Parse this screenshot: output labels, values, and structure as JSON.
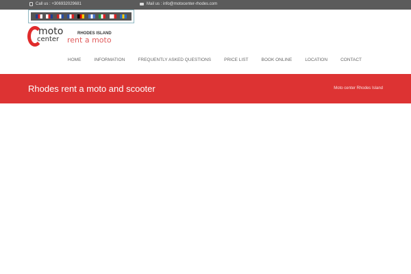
{
  "topbar": {
    "call": "Call us : +306932029681",
    "mail": "Mail us : info@motocenter-rhodes.com"
  },
  "flags": [
    {
      "lang": "English",
      "colors": [
        "#1f3f8f",
        "#d22",
        "#fff"
      ]
    },
    {
      "lang": "Czech",
      "colors": [
        "#fff",
        "#d22",
        "#1f3f8f"
      ]
    },
    {
      "lang": "Dutch",
      "colors": [
        "#c22",
        "#fff",
        "#2a4ea0"
      ]
    },
    {
      "lang": "French",
      "colors": [
        "#2a4ea0",
        "#fff",
        "#d22"
      ]
    },
    {
      "lang": "German",
      "colors": [
        "#000",
        "#d00",
        "#fc0"
      ]
    },
    {
      "lang": "Greek",
      "colors": [
        "#4a73c9",
        "#fff",
        "#4a73c9"
      ]
    },
    {
      "lang": "Italian",
      "colors": [
        "#1a9a3a",
        "#fff",
        "#d22"
      ]
    },
    {
      "lang": "Polish",
      "colors": [
        "#fff",
        "#fff",
        "#d22"
      ]
    },
    {
      "lang": "Swedish",
      "colors": [
        "#2a6cc0",
        "#fc0",
        "#2a6cc0"
      ]
    }
  ],
  "logo": {
    "moto": "moto",
    "center": "center",
    "island": "RHODES ISLAND",
    "tagline": "rent a moto"
  },
  "nav": [
    "HOME",
    "INFORMATION",
    "FREQUENTLY ASKED QUESTIONS",
    "PRICE LIST",
    "BOOK ONLINE",
    "LOCATION",
    "CONTACT"
  ],
  "banner": {
    "title": "Rhodes rent a moto and scooter",
    "breadcrumb": "Moto center Rhodes Island"
  },
  "colors": {
    "accent": "#dd3333",
    "topbar": "#5b5b5b"
  }
}
